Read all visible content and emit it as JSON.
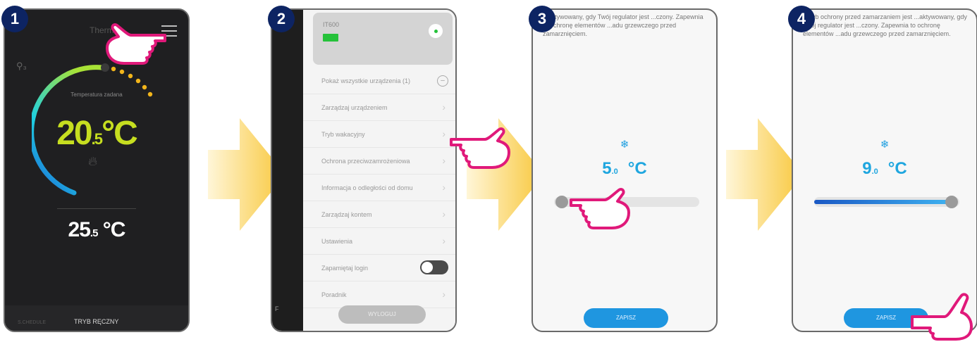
{
  "steps": [
    "1",
    "2",
    "3",
    "4"
  ],
  "screen1": {
    "title": "Thermo",
    "temperature_label": "Temperatura zadana",
    "current_temp_int": "20",
    "current_temp_dec": ".5",
    "current_temp_unit": "°C",
    "set_temp_int": "25",
    "set_temp_dec": ".5",
    "set_temp_unit": " °C",
    "mode_left": "S.CHEDULE",
    "mode_right": "TRYB RĘCZNY"
  },
  "screen2": {
    "device_name": "IT600",
    "menu": [
      {
        "label": "Pokaż wszystkie urządzenia (1)",
        "icon": "circle"
      },
      {
        "label": "Zarządzaj urządzeniem",
        "icon": "chevron"
      },
      {
        "label": "Tryb wakacyjny",
        "icon": "chevron"
      },
      {
        "label": "Ochrona przeciwzamrożeniowa",
        "icon": "chevron"
      },
      {
        "label": "Informacja o odległości od domu",
        "icon": "chevron"
      },
      {
        "label": "Zarządzaj kontem",
        "icon": "chevron"
      },
      {
        "label": "Ustawienia",
        "icon": "chevron"
      },
      {
        "label": "Zapamiętaj login",
        "icon": "toggle"
      },
      {
        "label": "Poradnik",
        "icon": "chevron"
      }
    ],
    "logout_label": "WYLOGUJ",
    "side_letter": "F"
  },
  "screen3": {
    "description": "...aktywowany, gdy Twój regulator jest ...czony. Zapewnia to ochronę elementów ...adu grzewczego przed zamarznięciem.",
    "temp_int": "5",
    "temp_dec": ".0",
    "unit": "°C",
    "slider_fraction": 0.0,
    "save_label": "ZAPISZ"
  },
  "screen4": {
    "description": "...tryb ochrony przed zamarzaniem jest ...aktywowany, gdy Twój regulator jest ...czony. Zapewnia to ochronę elementów ...adu grzewczego przed zamarznięciem.",
    "temp_int": "9",
    "temp_dec": ".0",
    "unit": "°C",
    "slider_fraction": 1.0,
    "save_label": "ZAPISZ"
  },
  "colors": {
    "badge": "#0d2463",
    "arrow": "#f8c73a",
    "hand": "#e0197a",
    "accent_green": "#c6de20",
    "accent_blue": "#1fa6df"
  },
  "icons": [
    "menu-icon",
    "hand-pointer-icon",
    "arrow-right-icon",
    "snowflake-icon",
    "flame-icon",
    "chevron-right-icon",
    "toggle-icon"
  ]
}
